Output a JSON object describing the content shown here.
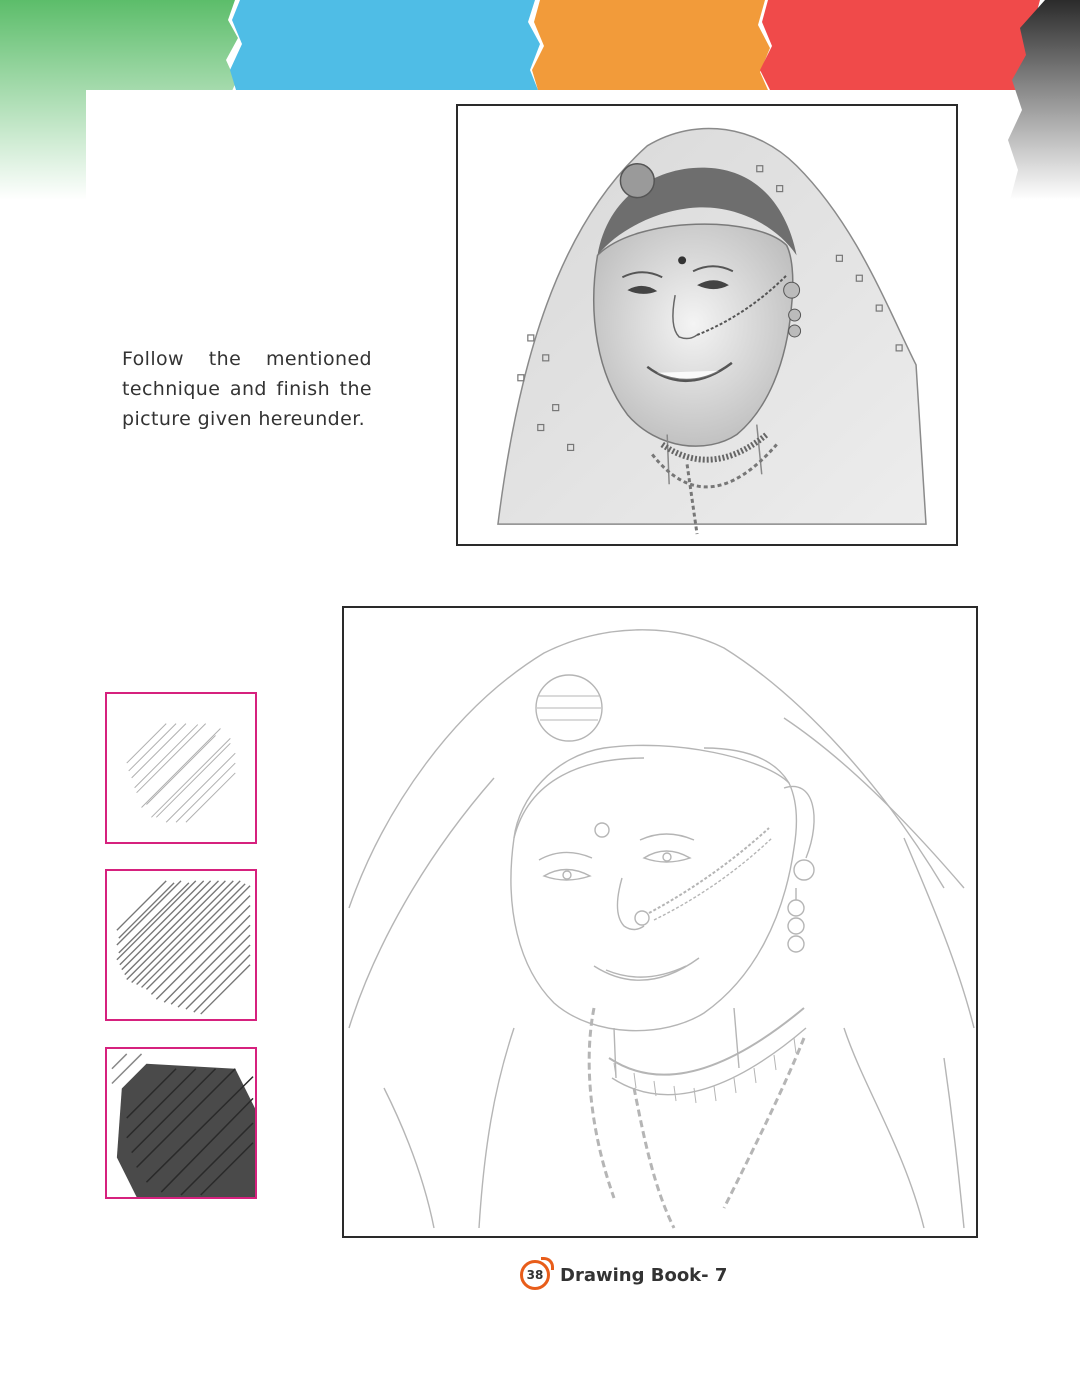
{
  "banner": {
    "colors": [
      "#5cbd6a",
      "#4fbde6",
      "#f29b3a",
      "#f04a4a",
      "#2b2b2b"
    ]
  },
  "instructions": {
    "text": "Follow the mentioned technique and finish the picture given hereunder."
  },
  "reference_drawing": {
    "icon": "shaded-portrait-sketch"
  },
  "outline_drawing": {
    "icon": "portrait-outline-sketch"
  },
  "technique_swatches": [
    {
      "icon": "light-shading-swatch",
      "level": "light"
    },
    {
      "icon": "medium-shading-swatch",
      "level": "medium"
    },
    {
      "icon": "dark-shading-swatch",
      "level": "dark"
    }
  ],
  "footer": {
    "page_number": "38",
    "book_title": "Drawing Book- 7",
    "accent": "#e85d1a"
  },
  "swatch_border_color": "#d6217e"
}
